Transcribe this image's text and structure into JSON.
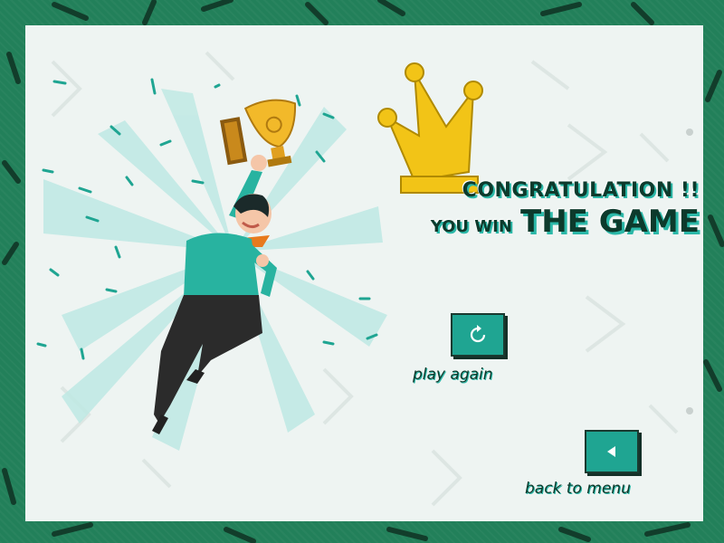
{
  "title": {
    "line1": "CONGRATULATION !!",
    "line2_small": "YOU WIN",
    "line2_big": "THE GAME"
  },
  "buttons": {
    "play_again": {
      "label": "play again",
      "icon": "replay-icon"
    },
    "back_to_menu": {
      "label": "back to menu",
      "icon": "back-arrow-icon"
    }
  },
  "colors": {
    "background": "#22805a",
    "panel": "#eef4f2",
    "accent": "#1fa592",
    "text_dark": "#0d3a2c",
    "crown": "#f2c417"
  }
}
